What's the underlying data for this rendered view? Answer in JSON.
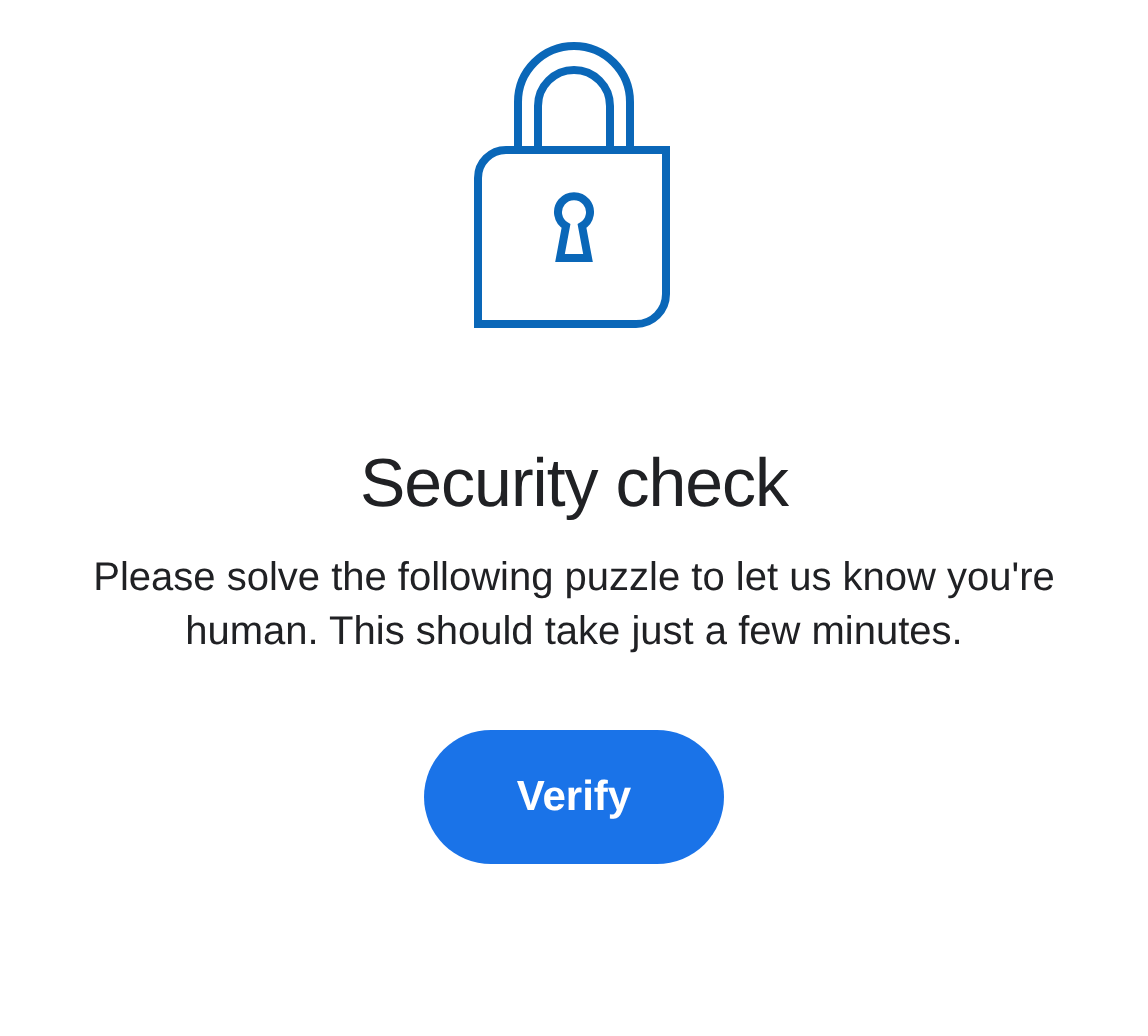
{
  "title": "Security check",
  "message": "Please solve the following puzzle to let us know you're human. This should take just a few minutes.",
  "button": "Verify"
}
